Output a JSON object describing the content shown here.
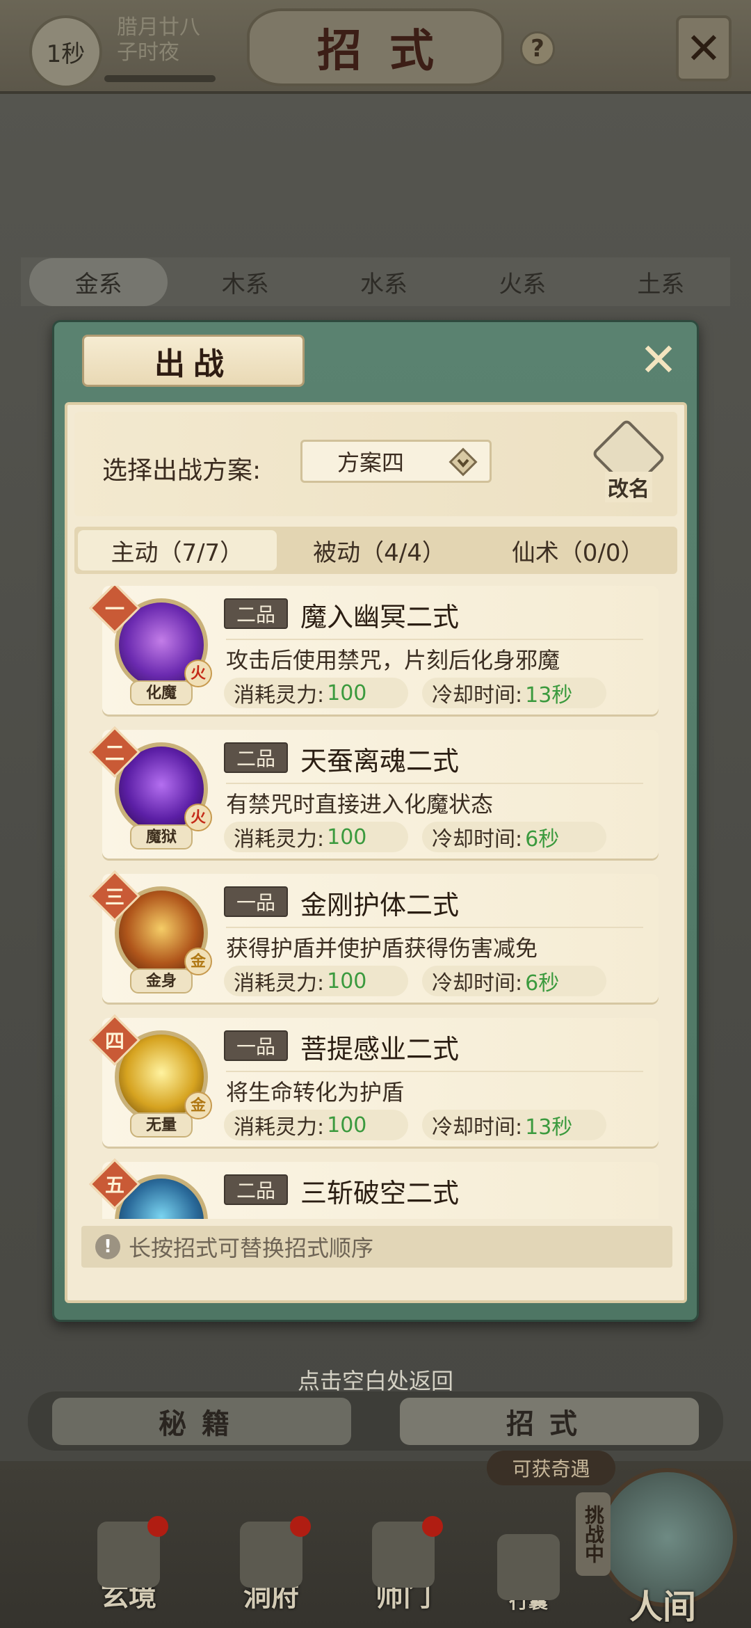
{
  "header": {
    "time_badge": "1秒",
    "date_line1": "腊月廿八",
    "date_line2": "子时夜",
    "title": "招式",
    "help_icon": "?",
    "close_icon": "✕"
  },
  "element_tabs": [
    "金系",
    "木系",
    "水系",
    "火系",
    "土系"
  ],
  "modal": {
    "title": "出战",
    "close_icon": "✕",
    "plan_label": "选择出战方案:",
    "plan_value": "方案四",
    "rename_label": "改名",
    "mode_tabs": [
      "主动（7/7）",
      "被动（4/4）",
      "仙术（0/0）"
    ],
    "cost_label": "消耗灵力:",
    "cooldown_label": "冷却时间:",
    "skills": [
      {
        "order": "一",
        "grade": "二品",
        "name": "魔入幽冥二式",
        "desc": "攻击后使用禁咒，片刻后化身邪魔",
        "cost": "100",
        "cooldown": "13秒",
        "icon_label": "化魔",
        "element": "火"
      },
      {
        "order": "二",
        "grade": "二品",
        "name": "天蚕离魂二式",
        "desc": "有禁咒时直接进入化魔状态",
        "cost": "100",
        "cooldown": "6秒",
        "icon_label": "魔狱",
        "element": "火"
      },
      {
        "order": "三",
        "grade": "一品",
        "name": "金刚护体二式",
        "desc": "获得护盾并使护盾获得伤害减免",
        "cost": "100",
        "cooldown": "6秒",
        "icon_label": "金身",
        "element": "金"
      },
      {
        "order": "四",
        "grade": "一品",
        "name": "菩提感业二式",
        "desc": "将生命转化为护盾",
        "cost": "100",
        "cooldown": "13秒",
        "icon_label": "无量",
        "element": "金"
      },
      {
        "order": "五",
        "grade": "二品",
        "name": "三斩破空二式"
      }
    ],
    "tip": "长按招式可替换招式顺序"
  },
  "back_hint": "点击空白处返回",
  "bottom_tabs": [
    "秘籍",
    "招式"
  ],
  "reward_tag": "可获奇遇",
  "challenge_tag": "挑战中",
  "nav": {
    "items": [
      "玄境",
      "洞府",
      "师门",
      "行囊"
    ],
    "world": "人间"
  }
}
